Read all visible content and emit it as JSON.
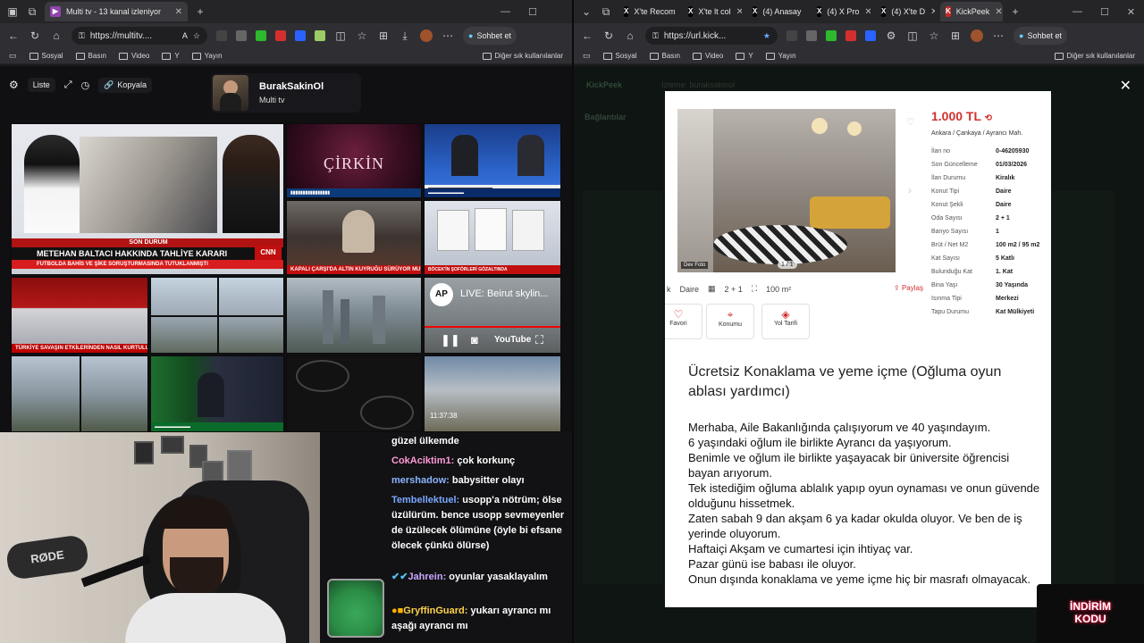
{
  "left_window": {
    "tab_title": "Multi tv - 13 kanal izleniyor",
    "url": "https://multitv....",
    "chat_btn": "Sohbet et",
    "bookmarks": [
      "Sosyal",
      "Basın",
      "Video",
      "Y",
      "Yayın"
    ],
    "bookmarks_other": "Diğer sık kullanılanlar",
    "toolbar": {
      "list_label": "Liste",
      "copy_label": "Kopyala"
    },
    "channel": {
      "name": "BurakSakinOl",
      "subtitle": "Multi tv"
    },
    "tiles": {
      "news1_headline": "METEHAN BALTACI HAKKINDA TAHLİYE KARARI",
      "news1_sub": "FUTBOLDA BAHİS VE ŞİKE SORUŞTURMASINDA TUTUKLANMIŞTI",
      "news1_badge": "SON DURUM",
      "show_title": "ÇİRKİN",
      "news3_banner": "KAPALI ÇARŞI'DA ALTIN KUYRUĞU SÜRÜYOR MU?",
      "news4_banner": "BÖCEK'İN ŞOFÖRLERİ GÖZALTINDA",
      "news5_banner": "TÜRKİYE SAVAŞIN ETKİLERİNDEN NASIL KURTULUR?",
      "ap_title": "LIVE: Beirut skylin...",
      "ap_logo": "AP",
      "yt_logo": "YouTube",
      "clock": "11:37:38"
    },
    "chat_messages": [
      {
        "user": "",
        "text": "güzel ülkemde",
        "color": "#ffffff"
      },
      {
        "user": "CokAciktim1:",
        "text": " çok korkunç",
        "color": "#ff9ad5"
      },
      {
        "user": "mershadow:",
        "text": " babysitter olayı",
        "color": "#8ab4ff"
      },
      {
        "user": "Tembellektuel:",
        "text": " usopp'a nötrüm; ölse üzülürüm. bence usopp sevmeyenler de üzülecek ölümüne (öyle bi efsane ölecek çünkü ölürse)",
        "color": "#7aa7ff"
      },
      {
        "user": "Jahrein:",
        "text": " oyunlar yasaklayalım",
        "color": "#c9a7ff"
      },
      {
        "user": "GryffinGuard:",
        "text": " yukarı ayrancı mı aşağı ayrancı mı",
        "color": "#ffd24a"
      }
    ]
  },
  "right_window": {
    "tabs": [
      "X'te Recom",
      "X'te lt col",
      "(4) Anasay",
      "(4) X Pro",
      "(4) X'te D",
      "KickPeek"
    ],
    "url": "https://url.kick...",
    "chat_btn": "Sohbet et",
    "bookmarks": [
      "Sosyal",
      "Basın",
      "Video",
      "Y",
      "Yayın"
    ],
    "bookmarks_other": "Diğer sık kullanılanlar",
    "app_name": "KickPeek",
    "bg_header": "İzleme: buraksakinol",
    "bg_section": "Bağlantılar",
    "listing": {
      "price": "1.000 TL",
      "location": "Ankara / Çankaya / Ayrancı Mah.",
      "photo_counter": "1 / 1",
      "photo_badge": "Dev Foto",
      "props": [
        {
          "k": "İlan no",
          "v": "0-46205930"
        },
        {
          "k": "Son Güncelleme",
          "v": "01/03/2026"
        },
        {
          "k": "İlan Durumu",
          "v": "Kiralık"
        },
        {
          "k": "Konut Tipi",
          "v": "Daire"
        },
        {
          "k": "Konut Şekli",
          "v": "Daire"
        },
        {
          "k": "Oda Sayısı",
          "v": "2 + 1"
        },
        {
          "k": "Banyo Sayısı",
          "v": "1"
        },
        {
          "k": "Brüt / Net M2",
          "v": "100 m2 / 95 m2"
        },
        {
          "k": "Kat Sayısı",
          "v": "5 Katlı"
        },
        {
          "k": "Bulunduğu Kat",
          "v": "1. Kat"
        },
        {
          "k": "Bina Yaşı",
          "v": "30 Yaşında"
        },
        {
          "k": "Isınma Tipi",
          "v": "Merkezi"
        },
        {
          "k": "Tapu Durumu",
          "v": "Kat Mülkiyeti"
        }
      ],
      "summary_type": "Daire",
      "summary_rooms": "2 + 1",
      "summary_area": "100 m²",
      "share": "Paylaş",
      "actions": [
        "Favori",
        "Konumu",
        "Yol Tarifi"
      ],
      "ad_title": "Ücretsiz Konaklama ve yeme içme (Oğluma oyun ablası yardımcı)",
      "ad_body": [
        "Merhaba, Aile Bakanlığında çalışıyorum ve 40 yaşındayım.",
        "6 yaşındaki oğlum ile birlikte Ayrancı da yaşıyorum.",
        "Benimle ve oğlum ile birlikte yaşayacak bir üniversite öğrencisi bayan arıyorum.",
        "Tek istediğim oğluma ablalık yapıp oyun oynaması ve onun güvende olduğunu hissetmek.",
        "Zaten sabah 9 dan akşam 6 ya kadar okulda oluyor. Ve ben de iş yerinde oluyorum.",
        "Haftaiçi Akşam ve cumartesi için ihtiyaç var.",
        "Pazar günü ise babası ile oluyor.",
        "Onun dışında konaklama ve yeme içme hiç bir masrafı olmayacak."
      ]
    },
    "indirim": "İNDİRİM KODU"
  }
}
